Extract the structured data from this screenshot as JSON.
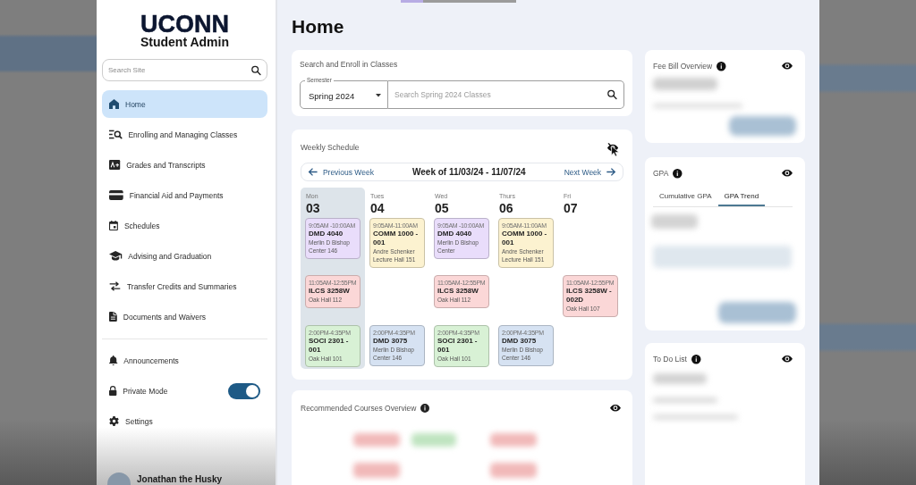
{
  "sidebar": {
    "logo": "UCONN",
    "subtitle": "Student Admin",
    "search": {
      "placeholder": "Search Site"
    },
    "nav_items": [
      {
        "label": "Home",
        "selected": true
      },
      {
        "label": "Enrolling and Managing Classes",
        "selected": false
      },
      {
        "label": "Grades and Transcripts",
        "selected": false
      },
      {
        "label": "Financial Aid and Payments",
        "selected": false
      },
      {
        "label": "Schedules",
        "selected": false
      },
      {
        "label": "Advising and Graduation",
        "selected": false
      },
      {
        "label": "Transfer Credits and Summaries",
        "selected": false
      },
      {
        "label": "Documents and Waivers",
        "selected": false
      }
    ],
    "utility_items": [
      {
        "kind": "link",
        "label": "Announcements"
      },
      {
        "kind": "toggle",
        "label": "Private Mode",
        "on": true
      },
      {
        "kind": "link",
        "label": "Settings"
      }
    ],
    "user": {
      "name": "Jonathan the Husky"
    }
  },
  "page_title": "Home",
  "enroll_card": {
    "title": "Search and Enroll in Classes",
    "semester": {
      "label": "Semester",
      "value": "Spring 2024"
    },
    "search": {
      "placeholder": "Search Spring 2024 Classes"
    }
  },
  "schedule": {
    "title": "Weekly Schedule",
    "previous": "Previous Week",
    "week": "Week of 11/03/24 - 11/07/24",
    "next": "Next Week",
    "days": [
      {
        "name": "Mon",
        "date": "03",
        "selected": true,
        "morning": {
          "time": "9:05AM -10:00AM",
          "course": "DMD 4040",
          "details": [
            "Merlin D Bishop",
            "Center 146"
          ],
          "color": "#e9ddfb"
        },
        "midday": {
          "time": "11:05AM-12:55PM",
          "course": "ILCS 3258W",
          "details": [
            "Oak Hall 112"
          ],
          "color": "#fbd7d7"
        },
        "afternoon": {
          "time": "2:00PM-4:35PM",
          "course": "SOCI 2301 - 001",
          "details": [
            "Oak Hall 101"
          ],
          "color": "#d8f1d5"
        }
      },
      {
        "name": "Tues",
        "date": "04",
        "selected": false,
        "morning": {
          "time": "9:05AM-11:00AM",
          "course": "COMM 1000 - 001",
          "details": [
            "Andre Schenker",
            "Lecture Hall 151"
          ],
          "color": "#fcf2d0"
        },
        "afternoon": {
          "time": "2:00PM-4:35PM",
          "course": "DMD 3075",
          "details": [
            "Merlin D Bishop",
            "Center 146"
          ],
          "color": "#d6e2f2"
        }
      },
      {
        "name": "Wed",
        "date": "05",
        "selected": false,
        "morning": {
          "time": "9:05AM -10:00AM",
          "course": "DMD 4040",
          "details": [
            "Merlin D Bishop",
            "Center"
          ],
          "color": "#e9ddfb"
        },
        "midday": {
          "time": "11:05AM-12:55PM",
          "course": "ILCS 3258W",
          "details": [
            "Oak Hall 112"
          ],
          "color": "#fbd7d7"
        },
        "afternoon": {
          "time": "2:00PM-4:35PM",
          "course": "SOCI 2301 - 001",
          "details": [
            "Oak Hall 101"
          ],
          "color": "#d8f1d5"
        }
      },
      {
        "name": "Thurs",
        "date": "06",
        "selected": false,
        "morning": {
          "time": "9:05AM-11:00AM",
          "course": "COMM 1000 - 001",
          "details": [
            "Andre Schenker",
            "Lecture Hall 151"
          ],
          "color": "#fcf2d0"
        },
        "afternoon": {
          "time": "2:00PM-4:35PM",
          "course": "DMD 3075",
          "details": [
            "Merlin D Bishop",
            "Center 146"
          ],
          "color": "#d6e2f2"
        }
      },
      {
        "name": "Fri",
        "date": "07",
        "selected": false,
        "midday": {
          "time": "11:05AM-12:55PM",
          "course": "ILCS 3258W - 002D",
          "details": [
            "Oak Hall 107"
          ],
          "color": "#fbd7d7"
        }
      }
    ]
  },
  "recommended": {
    "title": "Recommended Courses Overview"
  },
  "fee_bill": {
    "title": "Fee Bill Overview"
  },
  "gpa": {
    "title": "GPA",
    "tabs": [
      {
        "label": "Cumulative GPA",
        "selected": false
      },
      {
        "label": "GPA Trend",
        "selected": true
      }
    ]
  },
  "todo": {
    "title": "To Do List"
  }
}
